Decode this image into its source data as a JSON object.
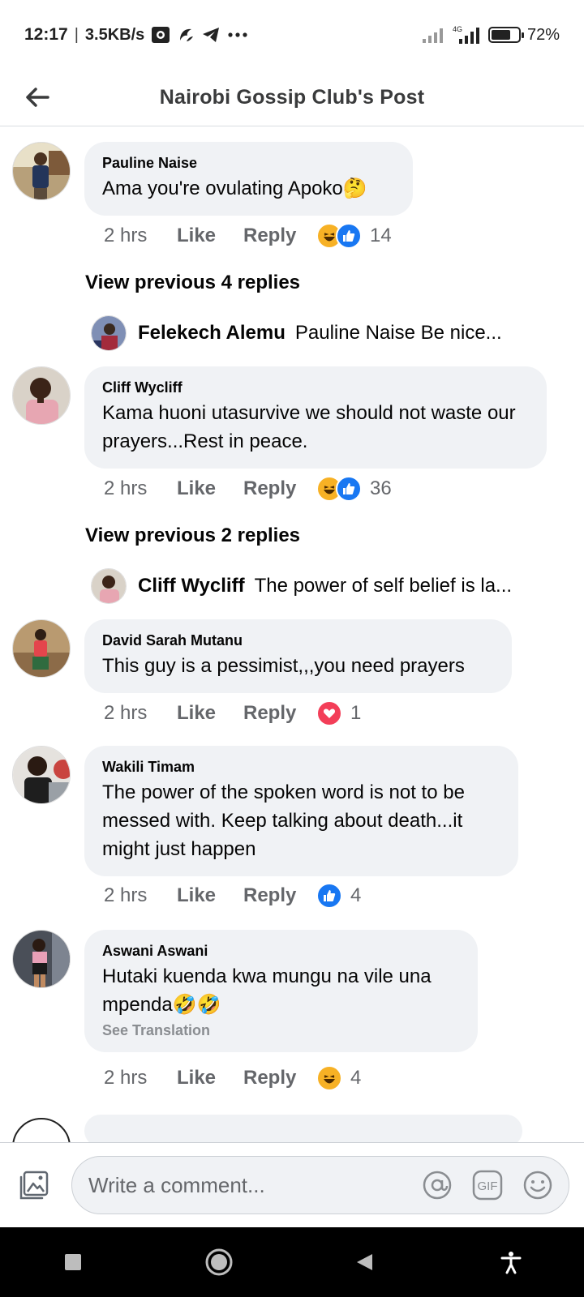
{
  "status_bar": {
    "time": "12:17",
    "separator": "|",
    "speed": "3.5KB/s",
    "network": "4G",
    "battery": "72%",
    "battery_level": 0.72,
    "icons": [
      "notification-icon",
      "app-icon",
      "telegram-icon",
      "more-dots-icon",
      "signal-icon",
      "signal-4g-icon",
      "battery-icon"
    ]
  },
  "header": {
    "title": "Nairobi Gossip Club's Post",
    "back_icon": "back-arrow-icon"
  },
  "comments": [
    {
      "author": "Pauline Naise",
      "text": "Ama you're ovulating Apoko🤔",
      "time": "2 hrs",
      "like": "Like",
      "reply": "Reply",
      "reactions": [
        "haha",
        "like"
      ],
      "reaction_count": "14"
    },
    {
      "author": "Cliff Wycliff",
      "text": "Kama huoni utasurvive we should not waste our prayers...Rest in peace.",
      "time": "2 hrs",
      "like": "Like",
      "reply": "Reply",
      "reactions": [
        "haha",
        "like"
      ],
      "reaction_count": "36"
    },
    {
      "author": "David Sarah Mutanu",
      "text": "This guy is a pessimist,,,you need prayers",
      "time": "2 hrs",
      "like": "Like",
      "reply": "Reply",
      "reactions": [
        "love"
      ],
      "reaction_count": "1"
    },
    {
      "author": "Wakili Timam",
      "text": "The power of the spoken word is not to be messed with. Keep talking about death...it might just happen",
      "time": "2 hrs",
      "like": "Like",
      "reply": "Reply",
      "reactions": [
        "like"
      ],
      "reaction_count": "4"
    },
    {
      "author": "Aswani Aswani",
      "text": "Hutaki kuenda kwa mungu na vile una mpenda🤣🤣",
      "see_translation": "See Translation",
      "time": "2 hrs",
      "like": "Like",
      "reply": "Reply",
      "reactions": [
        "haha"
      ],
      "reaction_count": "4"
    }
  ],
  "reply_threads": [
    {
      "view_previous": "View previous 4 replies",
      "preview_author": "Felekech Alemu",
      "preview_text": "Pauline Naise Be nice..."
    },
    {
      "view_previous": "View previous 2 replies",
      "preview_author": "Cliff Wycliff",
      "preview_text": "The power of self belief is la..."
    }
  ],
  "composer": {
    "placeholder": "Write a comment...",
    "icons": [
      "photo-icon",
      "mention-icon",
      "gif-icon",
      "emoji-icon"
    ],
    "gif_label": "GIF"
  },
  "nav_bar": {
    "icons": [
      "recents-square-icon",
      "home-circle-icon",
      "back-triangle-icon",
      "accessibility-icon"
    ]
  },
  "colors": {
    "bubble": "#f0f2f5",
    "meta_text": "#65676b",
    "like_blue": "#1877f2",
    "love_red": "#f33e58",
    "haha_yellow": "#f7b125"
  }
}
